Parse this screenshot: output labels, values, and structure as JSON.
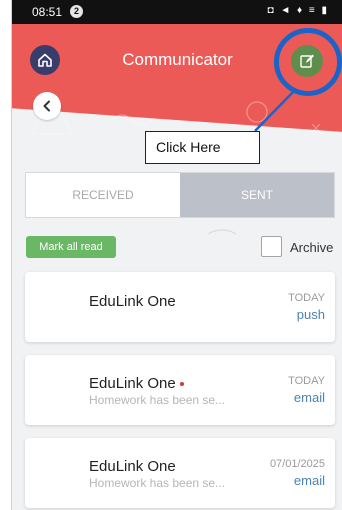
{
  "status_bar": {
    "time": "08:51",
    "badge": "2",
    "icons": "◘ ◄ ♦ ≡ ▮"
  },
  "header": {
    "title": "Communicator"
  },
  "callout": {
    "text": "Click Here"
  },
  "tabs": [
    {
      "label": "RECEIVED",
      "active": false
    },
    {
      "label": "SENT",
      "active": true
    }
  ],
  "actions": {
    "mark_all_read": "Mark all read",
    "archive_label": "Archive"
  },
  "messages": [
    {
      "sender": "EduLink One",
      "preview": "",
      "date": "TODAY",
      "type": "push",
      "unread": false
    },
    {
      "sender": "EduLink One",
      "preview": "Homework has been se...",
      "date": "TODAY",
      "type": "email",
      "unread": true
    },
    {
      "sender": "EduLink One",
      "preview": "Homework has been se...",
      "date": "07/01/2025",
      "type": "email",
      "unread": false
    }
  ],
  "colors": {
    "header": "#ec5a57",
    "home_button": "#3a3d6c",
    "compose_button": "#5f8e4c",
    "highlight_ring": "#1a64c9",
    "mark_read": "#6ab866",
    "type_link": "#4b83b8",
    "unread_dot": "#d9342f"
  },
  "icons": {
    "home": "home-icon",
    "compose": "edit-icon",
    "back": "chevron-left-icon",
    "status_badge": "notification-badge-icon"
  }
}
